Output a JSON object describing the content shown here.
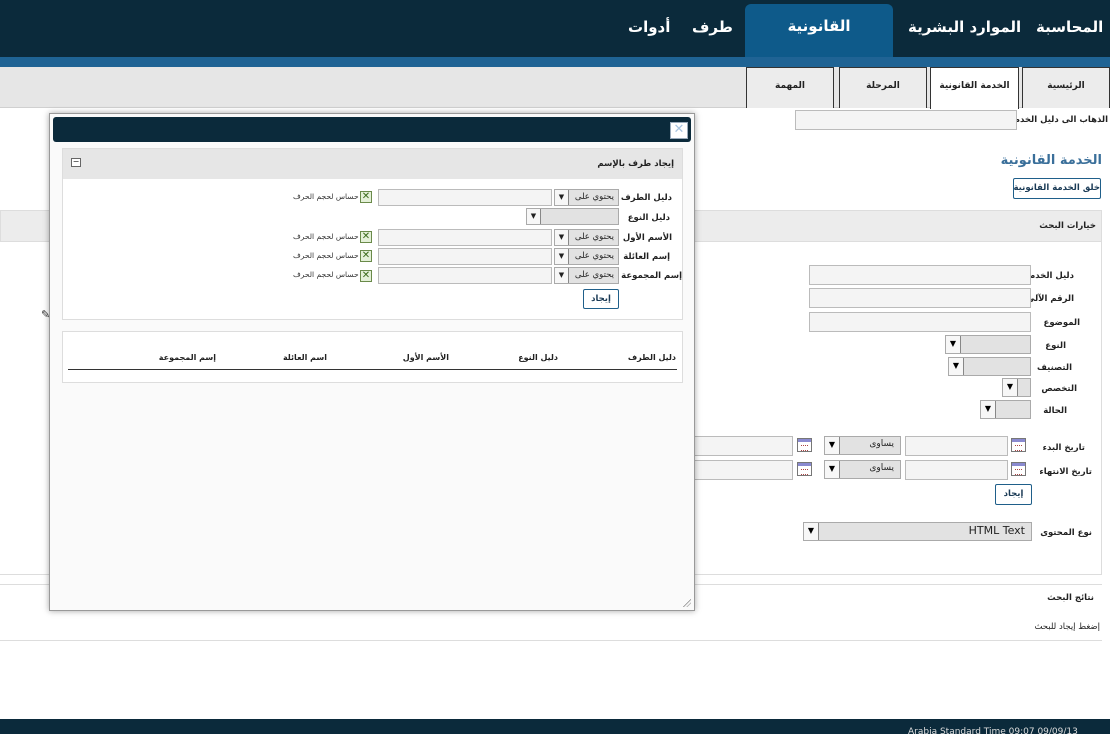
{
  "topnav": {
    "items": [
      {
        "label": "المحاسبة"
      },
      {
        "label": "الموارد البشرية"
      },
      {
        "label": "القانونية"
      },
      {
        "label": "طرف"
      },
      {
        "label": "أدوات"
      }
    ]
  },
  "tabs": [
    {
      "label": "الرئيسية"
    },
    {
      "label": "الخدمة القانونية"
    },
    {
      "label": "المرحلة"
    },
    {
      "label": "المهمة"
    }
  ],
  "page": {
    "goto_label": "الذهاب الى دليل الخدمة:",
    "title": "الخدمة القانونية",
    "create_button": "خلق الخدمة القانونية",
    "search_options": "خيارات البحث",
    "fields": {
      "service_guide": "دليل الخدمة",
      "auto_number": "الرقم الآلي",
      "subject": "الموضوع",
      "type": "النوع",
      "classification": "التصنيف",
      "specialization": "التخصص",
      "status": "الحالة",
      "start_date": "تاريخ البدء",
      "end_date": "تاريخ الانتهاء",
      "content_type": "نوع المحتوى"
    },
    "equals": "يساوى",
    "find_button": "إيجاد",
    "content_type_value": "HTML Text",
    "results_title": "نتائج البحث",
    "results_hint": "إضغط إيجاد للبحث",
    "footer_text": "Arabia Standard Time 09:07 09/09/13"
  },
  "dialog": {
    "close_glyph": "✕",
    "panel_title": "إيجاد طرف بالإسم",
    "collapse_glyph": "−",
    "fields": {
      "party_guide": "دليل الطرف",
      "type_guide": "دليل النوع",
      "first_name": "الأسم الأول",
      "family_name": "إسم العائلة",
      "group_name": "إسم المجموعة"
    },
    "contains": "يحتوي على",
    "case_sensitive": "حساس لحجم الحرف",
    "check_glyph": "✕",
    "find_button": "إيجاد",
    "columns": [
      "دليل الطرف",
      "دليل النوع",
      "الأسم الأول",
      "اسم العائلة",
      "إسم المجموعة"
    ]
  },
  "icons": {
    "dropdown_arrow": "▼",
    "calendar": "calendar-icon"
  },
  "colors": {
    "nav_bg": "#0b2a3b",
    "nav_active": "#0e5a8a",
    "accent_bar": "#1f6394",
    "title_blue": "#3a6f9a"
  }
}
